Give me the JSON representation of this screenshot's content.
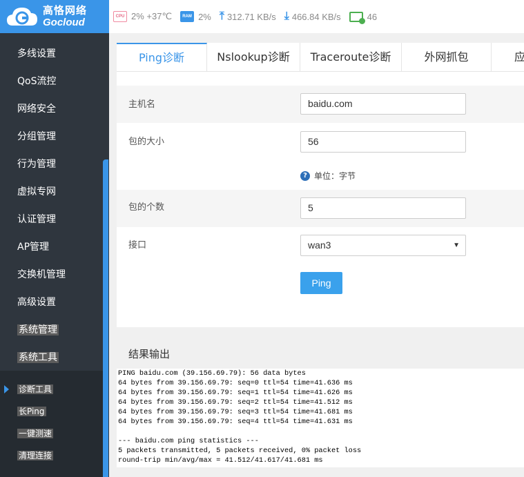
{
  "brand": {
    "name_cn": "高恪网络",
    "name_en": "Gocloud",
    "color": "#3a95e8"
  },
  "status": {
    "cpu_chip": "CPU",
    "cpu": "2% +37℃",
    "ram_chip": "RAM",
    "ram": "2%",
    "upload": "312.71 KB/s",
    "download": "466.84 KB/s",
    "terminals": "46"
  },
  "sidebar": {
    "items": [
      {
        "label": "多线设置"
      },
      {
        "label": "QoS流控"
      },
      {
        "label": "网络安全"
      },
      {
        "label": "分组管理"
      },
      {
        "label": "行为管理"
      },
      {
        "label": "虚拟专网"
      },
      {
        "label": "认证管理"
      },
      {
        "label": "AP管理"
      },
      {
        "label": "交换机管理"
      },
      {
        "label": "高级设置"
      },
      {
        "label": "系统管理"
      },
      {
        "label": "系统工具"
      }
    ],
    "subitems": [
      {
        "label": "诊断工具"
      },
      {
        "label": "长Ping"
      },
      {
        "label": "一键测速"
      },
      {
        "label": "清理连接"
      }
    ]
  },
  "tabs": [
    {
      "label": "Ping诊断"
    },
    {
      "label": "Nslookup诊断"
    },
    {
      "label": "Traceroute诊断"
    },
    {
      "label": "外网抓包"
    },
    {
      "label": "应"
    }
  ],
  "form": {
    "host": {
      "label": "主机名",
      "value": "baidu.com"
    },
    "size": {
      "label": "包的大小",
      "value": "56",
      "hint": "单位：字节"
    },
    "count": {
      "label": "包的个数",
      "value": "5"
    },
    "iface": {
      "label": "接口",
      "value": "wan3"
    },
    "submit": "Ping"
  },
  "result": {
    "title": "结果输出",
    "lines": [
      "PING baidu.com (39.156.69.79): 56 data bytes",
      "64 bytes from 39.156.69.79: seq=0 ttl=54 time=41.636 ms",
      "64 bytes from 39.156.69.79: seq=1 ttl=54 time=41.626 ms",
      "64 bytes from 39.156.69.79: seq=2 ttl=54 time=41.512 ms",
      "64 bytes from 39.156.69.79: seq=3 ttl=54 time=41.681 ms",
      "64 bytes from 39.156.69.79: seq=4 ttl=54 time=41.631 ms",
      "",
      "--- baidu.com ping statistics ---",
      "5 packets transmitted, 5 packets received, 0% packet loss",
      "round-trip min/avg/max = 41.512/41.617/41.681 ms"
    ]
  }
}
